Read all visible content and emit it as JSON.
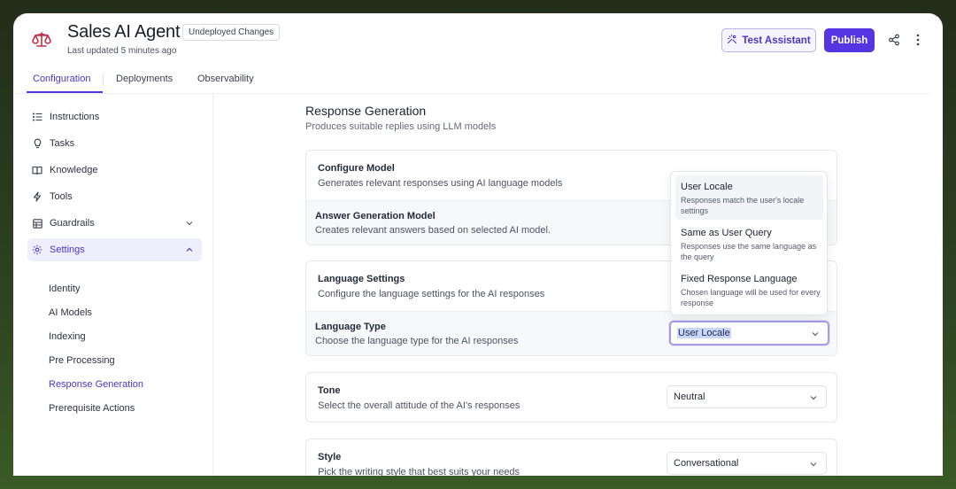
{
  "header": {
    "app_title": "Sales AI Agent",
    "status_badge": "Undeployed Changes",
    "last_updated": "Last updated 5 minutes ago",
    "test_button": "Test Assistant",
    "publish_button": "Publish"
  },
  "tabs": [
    {
      "label": "Configuration",
      "active": true
    },
    {
      "label": "Deployments",
      "active": false
    },
    {
      "label": "Observability",
      "active": false
    }
  ],
  "sidebar": {
    "items": [
      {
        "label": "Instructions",
        "icon": "list-icon"
      },
      {
        "label": "Tasks",
        "icon": "lightbulb-icon"
      },
      {
        "label": "Knowledge",
        "icon": "book-icon"
      },
      {
        "label": "Tools",
        "icon": "bolt-icon"
      },
      {
        "label": "Guardrails",
        "icon": "grid-icon"
      },
      {
        "label": "Settings",
        "icon": "gear-icon"
      }
    ],
    "settings_sub": [
      {
        "label": "Identity"
      },
      {
        "label": "AI Models"
      },
      {
        "label": "Indexing"
      },
      {
        "label": "Pre Processing"
      },
      {
        "label": "Response Generation"
      },
      {
        "label": "Prerequisite Actions"
      }
    ]
  },
  "main": {
    "title": "Response Generation",
    "description": "Produces suitable replies using LLM models",
    "configure_model": {
      "title": "Configure Model",
      "description": "Generates relevant responses using AI language models",
      "sub_title": "Answer Generation Model",
      "sub_description": "Creates relevant answers based on selected AI model."
    },
    "language_settings": {
      "title": "Language Settings",
      "description": "Configure the language settings for the AI responses",
      "sub_title": "Language Type",
      "sub_description": "Choose the language type for the AI responses",
      "selected": "User Locale"
    },
    "tone": {
      "title": "Tone",
      "description": "Select the overall attitude of the AI's responses",
      "selected": "Neutral"
    },
    "style": {
      "title": "Style",
      "description": "Pick the writing style that best suits your needs",
      "selected": "Conversational"
    }
  },
  "dropdown": {
    "options": [
      {
        "label": "User Locale",
        "description": "Responses match the user's locale settings"
      },
      {
        "label": "Same as User Query",
        "description": "Responses use the same language as the query"
      },
      {
        "label": "Fixed Response Language",
        "description": "Chosen language will be used for every response"
      }
    ]
  },
  "colors": {
    "accent": "#5336e2",
    "accent_text": "#4b36c8",
    "active_nav_bg": "#efeefc"
  }
}
